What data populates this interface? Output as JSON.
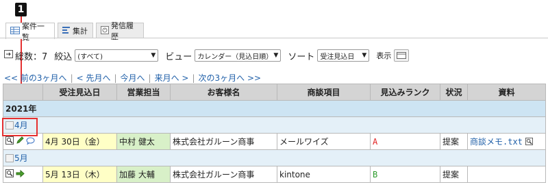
{
  "callout": {
    "number": "1"
  },
  "tabs": [
    {
      "label": "案件一覧",
      "icon": "table-list-icon",
      "active": true
    },
    {
      "label": "集計",
      "icon": "aggregate-icon",
      "active": false
    },
    {
      "label": "発信履歴",
      "icon": "history-icon",
      "active": false
    }
  ],
  "toolbar": {
    "total_label": "総数：7",
    "filter_label": "絞込",
    "filter_value": "(すべて)",
    "view_label": "ビュー",
    "view_value": "カレンダー（見込日順）",
    "sort_label": "ソート",
    "sort_value": "受注見込日",
    "display_label": "表示"
  },
  "nav": {
    "prev3": "<< 前の3ヶ月へ",
    "prev": "< 先月へ",
    "current": "今月へ",
    "next": "来月へ >",
    "next3": "次の3ヶ月へ >>"
  },
  "table": {
    "headers": [
      "受注見込日",
      "営業担当",
      "お客様名",
      "商談項目",
      "見込みランク",
      "状況",
      "資料"
    ],
    "year": "2021年",
    "months": [
      "4月",
      "5月"
    ],
    "rows": [
      {
        "date": "4月 30日（金）",
        "sales": "中村 健太",
        "customer": "株式会社ガルーン商事",
        "item": "メールワイズ",
        "rank": "A",
        "status": "提案",
        "doc": "商談メモ.txt"
      },
      {
        "date": "5月 13日（木）",
        "sales": "加藤 大輔",
        "customer": "株式会社ガルーン商事",
        "item": "kintone",
        "rank": "B",
        "status": "提案",
        "doc": ""
      }
    ]
  },
  "colors": {
    "link": "#1f5fa8",
    "callout": "#e53030",
    "rank_a": "#e02020",
    "rank_b": "#2a9a2a"
  }
}
